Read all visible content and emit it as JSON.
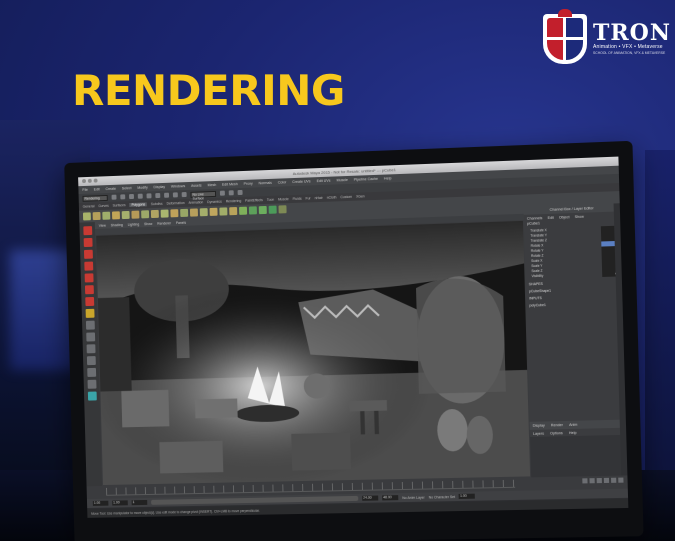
{
  "brand": {
    "name": "TRON",
    "tagline": "Animation • VFX • Metaverse",
    "subline": "SCHOOL OF ANIMATION, VFX & METAVERSE",
    "colors": {
      "red": "#c21f2c",
      "navy": "#1c2a7a"
    }
  },
  "headline": "RENDERING",
  "colors": {
    "accent": "#f7c81d",
    "background": "#1b2570"
  },
  "maya": {
    "window_title": "Autodesk Maya 2015 - Not for Resale: untitled* --- pCube1",
    "menus": [
      "File",
      "Edit",
      "Create",
      "Select",
      "Modify",
      "Display",
      "Windows",
      "Assets",
      "Mesh",
      "Edit Mesh",
      "Proxy",
      "Normals",
      "Color",
      "Create UVs",
      "Edit UVs",
      "Muscle",
      "Pipeline Cache",
      "Help"
    ],
    "mode": "Rendering",
    "live_surface": "No Live Surface",
    "shelf_tabs": [
      "General",
      "Curves",
      "Surfaces",
      "Polygons",
      "Subdivs",
      "Deformation",
      "Animation",
      "Dynamics",
      "Rendering",
      "PaintEffects",
      "Toon",
      "Muscle",
      "Fluids",
      "Fur",
      "nHair",
      "nCloth",
      "Custom",
      "XGen"
    ],
    "active_shelf": "Polygons",
    "panel_menu": [
      "View",
      "Shading",
      "Lighting",
      "Show",
      "Renderer",
      "Panels"
    ],
    "channel_box": {
      "header": "Channel Box / Layer Editor",
      "menu": [
        "Channels",
        "Edit",
        "Object",
        "Show"
      ],
      "object": "pCube1",
      "attributes": [
        {
          "name": "Translate X",
          "value": "0"
        },
        {
          "name": "Translate Y",
          "value": "0"
        },
        {
          "name": "Translate Z",
          "value": "0"
        },
        {
          "name": "Rotate X",
          "value": "0"
        },
        {
          "name": "Rotate Y",
          "value": "0"
        },
        {
          "name": "Rotate Z",
          "value": "0"
        },
        {
          "name": "Scale X",
          "value": "1"
        },
        {
          "name": "Scale Y",
          "value": "1"
        },
        {
          "name": "Scale Z",
          "value": "1"
        },
        {
          "name": "Visibility",
          "value": "on"
        }
      ],
      "shapes_label": "SHAPES",
      "shape": "pCubeShape1",
      "inputs_label": "INPUTS",
      "input": "polyCube1"
    },
    "layer_tabs": [
      "Display",
      "Render",
      "Anim"
    ],
    "layer_menu": [
      "Layers",
      "Options",
      "Help"
    ],
    "range": {
      "start": "1.00",
      "playback_start": "1.00",
      "current": "1",
      "playback_end": "24.00",
      "end": "48.00",
      "anim_layer": "No Anim Layer",
      "character_set": "No Character Set",
      "frame": "1.00"
    },
    "help_line": "Move Tool: Use manipulator to move object(s). Use edit mode to change pivot (INSERT). Ctrl+LMB to move perpendicular."
  }
}
